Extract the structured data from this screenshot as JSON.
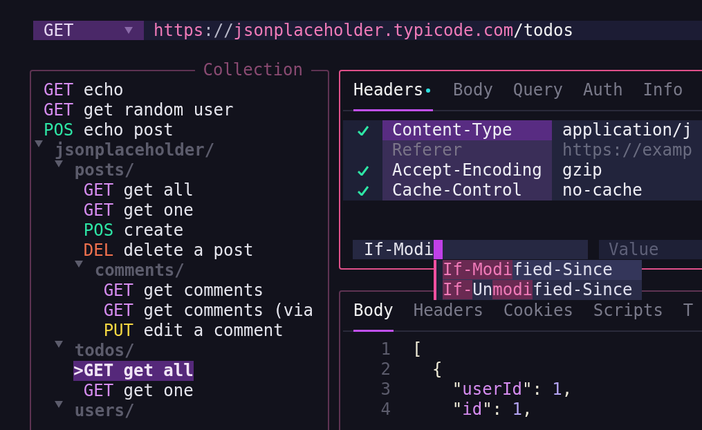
{
  "request_bar": {
    "method": "GET",
    "url": [
      {
        "text": "https",
        "kind": "scheme"
      },
      {
        "text": "://",
        "kind": "sep"
      },
      {
        "text": "jsonplaceholder.typicode.com",
        "kind": "host"
      },
      {
        "text": "/todos",
        "kind": "path"
      }
    ]
  },
  "collection": {
    "title": "Collection",
    "cursor_mark": ">",
    "items": [
      {
        "kind": "request",
        "method": "GET",
        "color": "#d68cf0",
        "name": "echo",
        "selected": false
      },
      {
        "kind": "request",
        "method": "GET",
        "color": "#d68cf0",
        "name": "get random user",
        "selected": false
      },
      {
        "kind": "request",
        "method": "POS",
        "color": "#2ee6a6",
        "name": "echo post",
        "selected": false
      },
      {
        "kind": "folder",
        "name": "jsonplaceholder/",
        "expanded": true,
        "children": [
          {
            "kind": "folder",
            "name": "posts/",
            "expanded": true,
            "children": [
              {
                "kind": "request",
                "method": "GET",
                "color": "#d68cf0",
                "name": "get all",
                "selected": false
              },
              {
                "kind": "request",
                "method": "GET",
                "color": "#d68cf0",
                "name": "get one",
                "selected": false
              },
              {
                "kind": "request",
                "method": "POS",
                "color": "#2ee6a6",
                "name": "create",
                "selected": false
              },
              {
                "kind": "request",
                "method": "DEL",
                "color": "#f2724e",
                "name": "delete a post",
                "selected": false
              },
              {
                "kind": "folder",
                "name": "comments/",
                "expanded": true,
                "children": [
                  {
                    "kind": "request",
                    "method": "GET",
                    "color": "#d68cf0",
                    "name": "get comments",
                    "selected": false
                  },
                  {
                    "kind": "request",
                    "method": "GET",
                    "color": "#d68cf0",
                    "name": "get comments (via",
                    "selected": false
                  },
                  {
                    "kind": "request",
                    "method": "PUT",
                    "color": "#f5d742",
                    "name": "edit a comment",
                    "selected": false
                  }
                ]
              }
            ]
          },
          {
            "kind": "folder",
            "name": "todos/",
            "expanded": true,
            "children": [
              {
                "kind": "request",
                "method": "GET",
                "name": "get all",
                "selected": true
              },
              {
                "kind": "request",
                "method": "GET",
                "color": "#d68cf0",
                "name": "get one",
                "selected": false
              }
            ]
          },
          {
            "kind": "folder",
            "name": "users/",
            "expanded": true
          }
        ]
      }
    ]
  },
  "request_panel": {
    "tabs": [
      {
        "label": "Headers",
        "selected": true,
        "modified": true
      },
      {
        "label": "Body",
        "selected": false,
        "modified": false
      },
      {
        "label": "Query",
        "selected": false,
        "modified": false
      },
      {
        "label": "Auth",
        "selected": false,
        "modified": false
      },
      {
        "label": "Info",
        "selected": false,
        "modified": false
      }
    ],
    "headers": [
      {
        "enabled": true,
        "selected": true,
        "name": "Content-Type",
        "value": "application/j"
      },
      {
        "enabled": false,
        "selected": false,
        "name": "Referer",
        "value": "https://examp"
      },
      {
        "enabled": true,
        "selected": false,
        "name": "Accept-Encoding",
        "value": "gzip"
      },
      {
        "enabled": true,
        "selected": false,
        "name": "Cache-Control",
        "value": "no-cache"
      }
    ],
    "new_header": {
      "name_value": "If-Modi",
      "value_placeholder": "Value"
    },
    "suggestions": [
      {
        "selected": true,
        "parts": [
          {
            "text": "If-Modi",
            "match": true
          },
          {
            "text": "fied-Since",
            "match": false
          }
        ]
      },
      {
        "selected": false,
        "parts": [
          {
            "text": "If-",
            "match": true
          },
          {
            "text": "Un",
            "match": false
          },
          {
            "text": "modi",
            "match": true
          },
          {
            "text": "fied-Since",
            "match": false
          }
        ]
      }
    ]
  },
  "response_panel": {
    "tabs": [
      {
        "label": "Body",
        "selected": true
      },
      {
        "label": "Headers",
        "selected": false
      },
      {
        "label": "Cookies",
        "selected": false
      },
      {
        "label": "Scripts",
        "selected": false
      },
      {
        "label": "T",
        "selected": false
      }
    ],
    "lines": [
      {
        "number": "1",
        "current": false,
        "tokens": [
          {
            "text": "[",
            "kind": "punct"
          }
        ]
      },
      {
        "number": "2",
        "current": false,
        "tokens": [
          {
            "text": "  {",
            "kind": "punct"
          }
        ]
      },
      {
        "number": "3",
        "current": false,
        "tokens": [
          {
            "text": "    \"",
            "kind": "punct"
          },
          {
            "text": "userId",
            "kind": "key"
          },
          {
            "text": "\": ",
            "kind": "punct"
          },
          {
            "text": "1",
            "kind": "number"
          },
          {
            "text": ",",
            "kind": "punct"
          }
        ]
      },
      {
        "number": "4",
        "current": false,
        "tokens": [
          {
            "text": "    \"",
            "kind": "punct"
          },
          {
            "text": "id",
            "kind": "key"
          },
          {
            "text": "\": ",
            "kind": "punct"
          },
          {
            "text": "1",
            "kind": "number"
          },
          {
            "text": ",",
            "kind": "punct"
          }
        ]
      }
    ]
  }
}
